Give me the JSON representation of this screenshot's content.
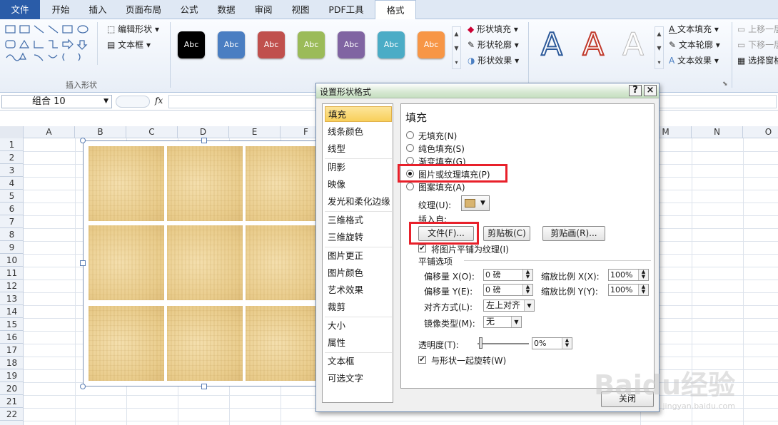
{
  "tabs": [
    "文件",
    "开始",
    "插入",
    "页面布局",
    "公式",
    "数据",
    "审阅",
    "视图",
    "PDF工具",
    "格式"
  ],
  "ribbon": {
    "insert_shape": {
      "label": "插入形状",
      "edit_shape": "编辑形状",
      "text_box": "文本框"
    },
    "shape_styles": {
      "sample": "Abc",
      "colors": [
        "#000000",
        "#4a7ec2",
        "#c0504d",
        "#9bbb59",
        "#8064a2",
        "#4bacc6",
        "#f79646"
      ],
      "fill": "形状填充",
      "outline": "形状轮廓",
      "effect": "形状效果"
    },
    "wordart": {
      "letter": "A",
      "text_fill": "文本填充",
      "text_outline": "文本轮廓",
      "text_effect": "文本效果"
    },
    "arrange": {
      "bring_forward": "上移一层",
      "send_backward": "下移一层",
      "selection_pane": "选择窗格"
    }
  },
  "formula_bar": {
    "name_box": "组合 10",
    "fx": "fx"
  },
  "columns": [
    "A",
    "B",
    "C",
    "D",
    "E",
    "F",
    "M",
    "N",
    "O"
  ],
  "rows": [
    "1",
    "2",
    "3",
    "4",
    "5",
    "6",
    "7",
    "8",
    "9",
    "10",
    "11",
    "12",
    "13",
    "14",
    "15",
    "16",
    "17",
    "18",
    "19",
    "20",
    "21",
    "22"
  ],
  "dialog": {
    "title": "设置形状格式",
    "help": "?",
    "close_x": "×",
    "nav": [
      "填充",
      "线条颜色",
      "线型",
      "阴影",
      "映像",
      "发光和柔化边缘",
      "三维格式",
      "三维旋转",
      "图片更正",
      "图片颜色",
      "艺术效果",
      "裁剪",
      "大小",
      "属性",
      "文本框",
      "可选文字"
    ],
    "selected_nav": "填充",
    "pane": {
      "heading": "填充",
      "options": [
        "无填充(N)",
        "纯色填充(S)",
        "渐变填充(G)",
        "图片或纹理填充(P)",
        "图案填充(A)"
      ],
      "selected_option": "图片或纹理填充(P)",
      "texture_label": "纹理(U):",
      "insert_from": "插入自:",
      "btn_file": "文件(F)...",
      "btn_clipboard": "剪贴板(C)",
      "btn_clipart": "剪贴画(R)...",
      "tile_checkbox": "将图片平铺为纹理(I)",
      "tile_checked": true,
      "tile_options": "平铺选项",
      "offset_x_label": "偏移量 X(O):",
      "offset_x": "0 磅",
      "scale_x_label": "缩放比例 X(X):",
      "scale_x": "100%",
      "offset_y_label": "偏移量 Y(E):",
      "offset_y": "0 磅",
      "scale_y_label": "缩放比例 Y(Y):",
      "scale_y": "100%",
      "align_label": "对齐方式(L):",
      "align": "左上对齐",
      "mirror_label": "镜像类型(M):",
      "mirror": "无",
      "transparency_label": "透明度(T):",
      "transparency": "0%",
      "rotate_label": "与形状一起旋转(W)",
      "rotate_checked": true
    },
    "close_button": "关闭"
  },
  "watermark": "Baidu经验",
  "watermark_sub": "jingyan.baidu.com"
}
